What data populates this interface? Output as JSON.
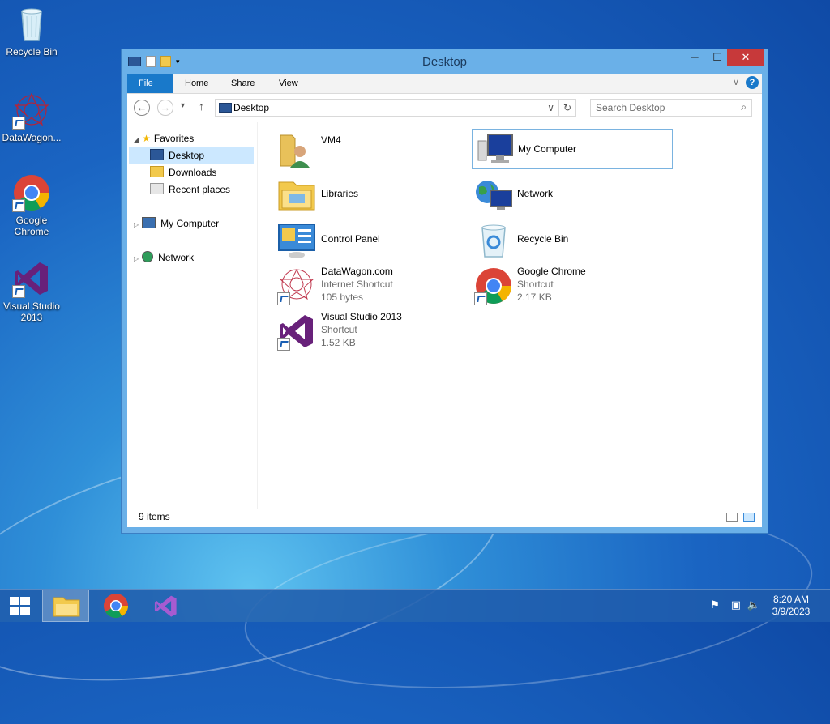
{
  "desktop": {
    "icons": [
      {
        "label": "Recycle Bin"
      },
      {
        "label": "DataWagon..."
      },
      {
        "label": "Google Chrome"
      },
      {
        "label": "Visual Studio 2013"
      }
    ]
  },
  "window": {
    "title": "Desktop",
    "ribbon_tabs": [
      "File",
      "Home",
      "Share",
      "View"
    ],
    "address": "Desktop",
    "search_placeholder": "Search Desktop",
    "nav": {
      "favorites": "Favorites",
      "desktop": "Desktop",
      "downloads": "Downloads",
      "recent": "Recent places",
      "my_computer": "My Computer",
      "network": "Network"
    },
    "items": [
      {
        "name": "VM4",
        "sub1": "",
        "sub2": ""
      },
      {
        "name": "My Computer",
        "sub1": "",
        "sub2": ""
      },
      {
        "name": "Libraries",
        "sub1": "",
        "sub2": ""
      },
      {
        "name": "Network",
        "sub1": "",
        "sub2": ""
      },
      {
        "name": "Control Panel",
        "sub1": "",
        "sub2": ""
      },
      {
        "name": "Recycle Bin",
        "sub1": "",
        "sub2": ""
      },
      {
        "name": "DataWagon.com",
        "sub1": "Internet Shortcut",
        "sub2": "105 bytes"
      },
      {
        "name": "Google Chrome",
        "sub1": "Shortcut",
        "sub2": "2.17 KB"
      },
      {
        "name": "Visual Studio 2013",
        "sub1": "Shortcut",
        "sub2": "1.52 KB"
      }
    ],
    "status": "9 items"
  },
  "taskbar": {
    "time": "8:20 AM",
    "date": "3/9/2023"
  },
  "colors": {
    "accent": "#1979ca",
    "close": "#c7393a",
    "vs_purple": "#68217a"
  }
}
